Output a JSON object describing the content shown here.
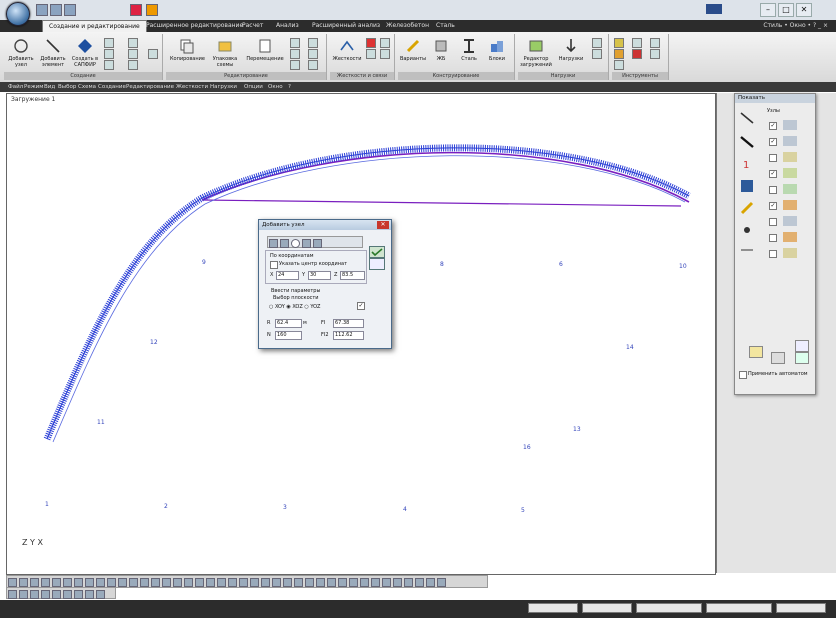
{
  "titlebar": {
    "title": ""
  },
  "ribbon": {
    "tabs": [
      "Создание и редактирование",
      "Расширенное редактирование",
      "Расчет",
      "Анализ",
      "Расширенный анализ",
      "Железобетон",
      "Сталь"
    ],
    "right_tools": "Стиль • Окно • ? _ ⨯",
    "groups": [
      {
        "title": "Создание",
        "buttons": [
          "Добавить узел",
          "Добавить элемент",
          "Создать в САПФИР"
        ]
      },
      {
        "title": "Редактирование",
        "buttons": [
          "Копирование",
          "Упаковка схемы",
          "Перемещение"
        ]
      },
      {
        "title": "Жесткости и связи",
        "buttons": [
          "Жесткости"
        ]
      },
      {
        "title": "Конструирование",
        "buttons": [
          "Варианты",
          "ЖБ",
          "Сталь",
          "Блоки"
        ]
      },
      {
        "title": "Нагрузки",
        "buttons": [
          "Редактор загружений",
          "Нагрузки"
        ]
      },
      {
        "title": "Инструменты",
        "buttons": []
      }
    ]
  },
  "menubar": {
    "items": [
      "Файл",
      "Режим",
      "Вид",
      "Выбор",
      "Схема",
      "Создание",
      "Редактирование",
      "Жесткости",
      "Нагрузки",
      "Опции",
      "Окно",
      "?"
    ]
  },
  "canvas": {
    "loading_label": "Загружение 1",
    "node_labels": [
      "9",
      "12",
      "11",
      "8",
      "6",
      "10",
      "14",
      "13",
      "16",
      "1",
      "2",
      "3",
      "4",
      "5"
    ],
    "axes": "Z Y X"
  },
  "dialog": {
    "title": "Добавить узел",
    "close": "✕",
    "by_coords_label": "По координатам",
    "center_checkbox": "Указать центр координат",
    "x_label": "X",
    "x_value": "24",
    "y_label": "Y",
    "y_value": "30",
    "z_label": "Z",
    "z_value": "83.5",
    "params_label": "Ввести параметры",
    "plane_label": "Выбор плоскости",
    "plane_options": [
      "XOY",
      "XOZ",
      "YOZ"
    ],
    "r_label": "R",
    "r_value": "62.4",
    "unit": "м",
    "fi_label": "FI",
    "fi_value": "67.38",
    "n_label": "N",
    "n_value": "160",
    "fi2_label": "FI2",
    "fi2_value": "112.62"
  },
  "show_panel": {
    "title": "Показать",
    "nodes_label": "Узлы",
    "apply_label": "Применить автоматом",
    "checked": [
      true,
      true,
      false,
      true,
      false,
      true,
      false,
      false,
      false
    ]
  },
  "statusbar": {
    "zoom": "",
    "fields": [
      "",
      "",
      "",
      "",
      ""
    ]
  },
  "colors": {
    "blue_structure": "#2b3fd6",
    "purple_contour": "#7a1fbf",
    "accent": "#3d6fa3"
  }
}
